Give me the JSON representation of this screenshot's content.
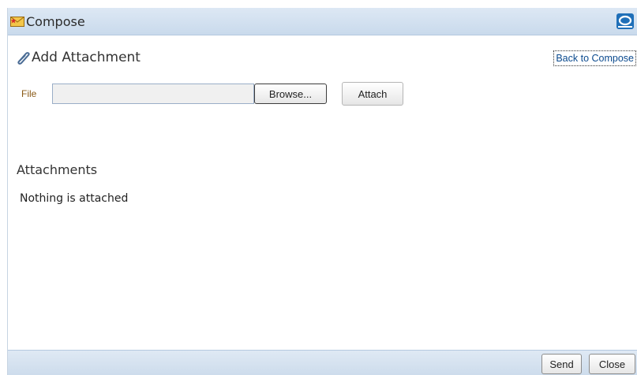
{
  "window": {
    "title": "Compose",
    "title_icon": "envelope-star-icon",
    "brand_icon": "oracle-logo-icon"
  },
  "add_attachment": {
    "heading": "Add Attachment",
    "heading_icon": "paperclip-icon",
    "back_link": "Back to Compose",
    "file_label": "File",
    "file_value": "",
    "browse_label": "Browse...",
    "attach_label": "Attach"
  },
  "attachments": {
    "heading": "Attachments",
    "empty_message": "Nothing is attached"
  },
  "footer": {
    "send_label": "Send",
    "close_label": "Close"
  },
  "colors": {
    "title_bar": "#c9daec",
    "link": "#0b4a8e",
    "file_label": "#8a5a16"
  }
}
